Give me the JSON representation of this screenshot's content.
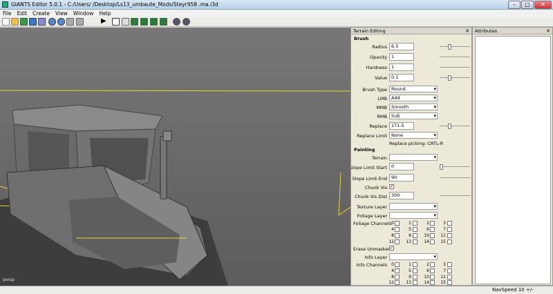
{
  "window": {
    "title": "GIANTS Editor 5.0.1 - C:/Users/                    /Desktop/Ls13_umbaute_Mods/Steyr958 .ma.i3d",
    "min": "–",
    "max": "□",
    "close": "✕"
  },
  "menu": [
    "File",
    "Edit",
    "Create",
    "View",
    "Window",
    "Help"
  ],
  "toolbar": {
    "icons": [
      "new-icon",
      "open-icon",
      "save-icon",
      "save-as-icon",
      "import-icon",
      "undo-icon",
      "redo-icon",
      "play-icon",
      "select-icon",
      "move-icon",
      "terrain-sculpt-icon",
      "terrain-paint-icon",
      "foliage-paint-icon",
      "settings-icon",
      "snap-icon"
    ]
  },
  "viewport": {
    "label": "persp"
  },
  "terrain_panel": {
    "title": "Terrain Editing",
    "close": "✕",
    "brush_header": "Brush",
    "radius_label": "Radius",
    "radius_value": "6.5",
    "opacity_label": "Opacity",
    "opacity_value": "1",
    "hardness_label": "Hardness",
    "hardness_value": "1",
    "value_label": "Value",
    "value_value": "0.1",
    "brush_type_label": "Brush Type",
    "brush_type_value": "Round",
    "lmb_label": "LMB",
    "lmb_value": "Add",
    "mmb_label": "MMB",
    "mmb_value": "Smooth",
    "rmb_label": "RMB",
    "rmb_value": "Sub",
    "replace_label": "Replace",
    "replace_value": "171.5",
    "replace_limit_label": "Replace Limit",
    "replace_limit_value": "None",
    "replace_picking": "Replace picking: CRTL-R",
    "painting_header": "Painting",
    "terrain_label": "Terrain",
    "terrain_value": "",
    "slope_start_label": "Slope Limit Start",
    "slope_start_value": "0",
    "slope_end_label": "Slope Limit End",
    "slope_end_value": "90",
    "chunk_vis_label": "Chunk Vis",
    "chunk_vis_checked": "✓",
    "chunk_vis_dist_label": "Chunk Vis Dist",
    "chunk_vis_dist_value": "300",
    "texture_layer_label": "Texture Layer",
    "texture_layer_value": "",
    "foliage_layer_label": "Foliage Layer",
    "foliage_layer_value": "",
    "foliage_channels_label": "Foliage Channels",
    "erase_unmasked_label": "Erase Unmasked",
    "erase_unmasked_checked": "✓",
    "info_layer_label": "Info Layer",
    "info_layer_value": "",
    "info_channels_label": "Info Channels",
    "channels": [
      "0",
      "1",
      "2",
      "3",
      "4",
      "5",
      "6",
      "7",
      "8",
      "9",
      "10",
      "11",
      "12",
      "13",
      "14",
      "15"
    ]
  },
  "attributes_panel": {
    "title": "Attributes",
    "close": "✕"
  },
  "status": {
    "navspeed": "NavSpeed 10 +/-"
  }
}
